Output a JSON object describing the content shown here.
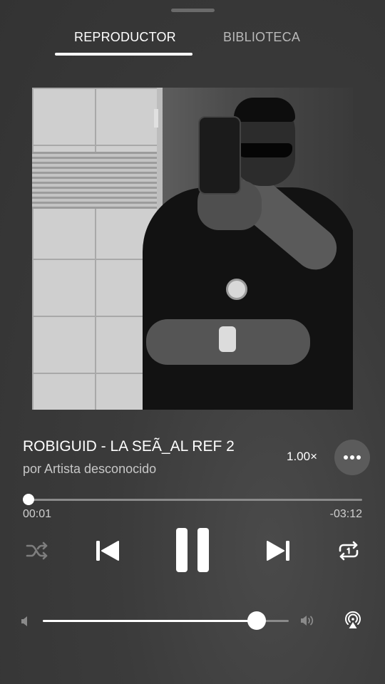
{
  "tabs": [
    {
      "label": "REPRODUCTOR",
      "active": true
    },
    {
      "label": "BIBLIOTECA",
      "active": false
    }
  ],
  "track": {
    "title": "ROBIGUID - LA SEÃ_AL REF 2",
    "artist": "por Artista desconocido",
    "playback_speed": "1.00×"
  },
  "progress": {
    "elapsed": "00:01",
    "remaining": "-03:12",
    "fraction": 0.005
  },
  "volume": {
    "fraction": 0.87
  },
  "icons": {
    "more": "more-horizontal-icon",
    "shuffle": "shuffle-icon",
    "previous": "skip-previous-icon",
    "pause": "pause-icon",
    "next": "skip-next-icon",
    "repeat": "repeat-one-icon",
    "volume_low": "volume-low-icon",
    "volume_high": "volume-high-icon",
    "airplay": "airplay-icon"
  },
  "colors": {
    "background": "#3b3b3b",
    "foreground": "#ffffff",
    "muted": "#8a8a8a"
  }
}
